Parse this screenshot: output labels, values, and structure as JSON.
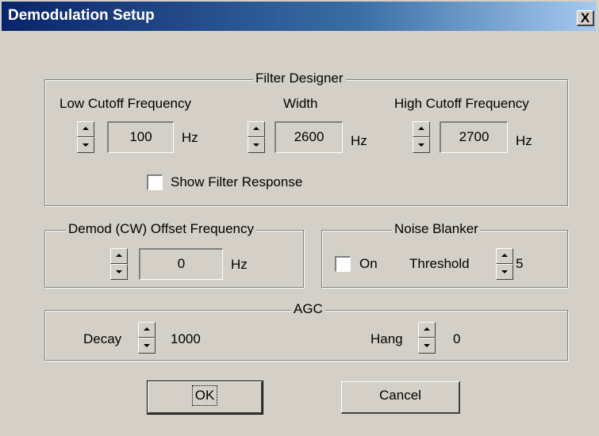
{
  "window": {
    "title": "Demodulation Setup",
    "close_label": "X"
  },
  "filter_designer": {
    "legend": "Filter Designer",
    "low_cutoff": {
      "label": "Low Cutoff Frequency",
      "value": "100",
      "unit": "Hz"
    },
    "width": {
      "label": "Width",
      "value": "2600",
      "unit": "Hz"
    },
    "high_cutoff": {
      "label": "High Cutoff Frequency",
      "value": "2700",
      "unit": "Hz"
    },
    "show_response": {
      "label": "Show Filter Response",
      "checked": false
    }
  },
  "demod_offset": {
    "legend": "Demod (CW) Offset Frequency",
    "value": "0",
    "unit": "Hz"
  },
  "noise_blanker": {
    "legend": "Noise Blanker",
    "on_label": "On",
    "on_checked": false,
    "threshold_label": "Threshold",
    "threshold_value": "5"
  },
  "agc": {
    "legend": "AGC",
    "decay_label": "Decay",
    "decay_value": "1000",
    "hang_label": "Hang",
    "hang_value": "0"
  },
  "buttons": {
    "ok": "OK",
    "cancel": "Cancel"
  }
}
